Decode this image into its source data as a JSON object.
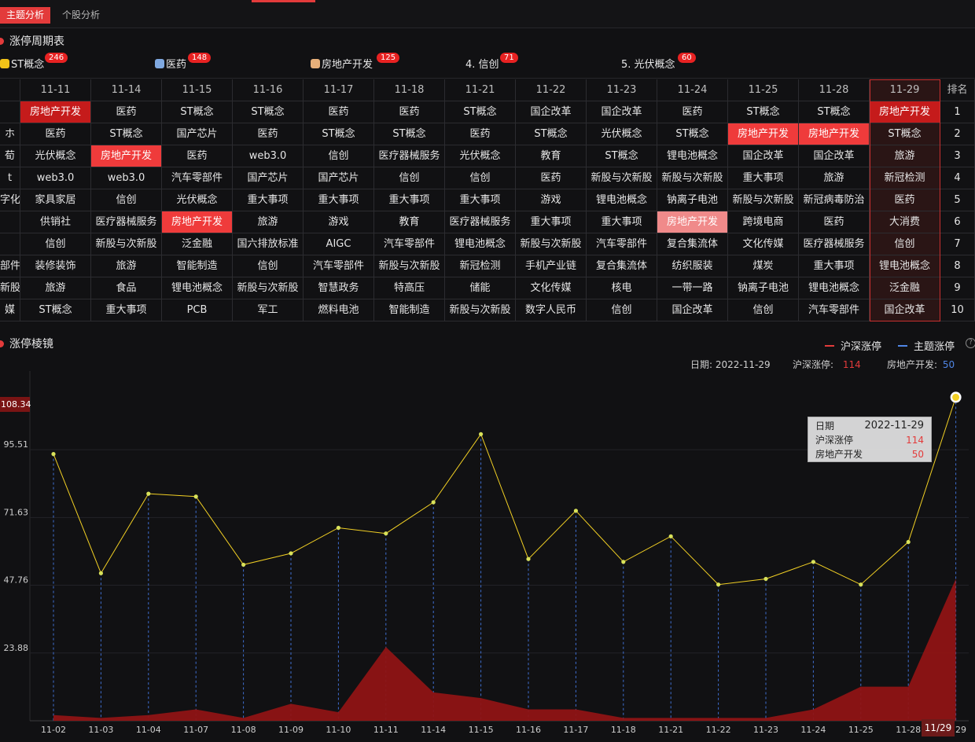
{
  "tabs": {
    "active": "主题分析",
    "other": "个股分析"
  },
  "limit_table": {
    "title": "涨停周期表",
    "themes": [
      {
        "rank_label": "",
        "name": "ST概念",
        "count": "246",
        "icon_color": "#f2c318",
        "icon": "hexagon-icon"
      },
      {
        "rank_label": "",
        "name": "医药",
        "count": "148",
        "icon_color": "#7fa8e0",
        "icon": "hexagon-icon"
      },
      {
        "rank_label": "",
        "name": "房地产开发",
        "count": "125",
        "icon_color": "#e8b07a",
        "icon": "hexagon-icon"
      },
      {
        "rank_label": "4.",
        "name": "信创",
        "count": "71",
        "icon_color": "",
        "icon": ""
      },
      {
        "rank_label": "5.",
        "name": "光伏概念",
        "count": "60",
        "icon_color": "",
        "icon": ""
      }
    ],
    "partial_col_header": "",
    "dates": [
      "11-11",
      "11-14",
      "11-15",
      "11-16",
      "11-17",
      "11-18",
      "11-21",
      "11-22",
      "11-23",
      "11-24",
      "11-25",
      "11-28",
      "11-29"
    ],
    "rank_header": "排名",
    "partial_col": [
      "",
      "ホ",
      "荀",
      "t",
      "字化",
      "",
      "",
      "部件",
      "新股",
      "媒"
    ],
    "rows": [
      [
        "房地产开发",
        "医药",
        "ST概念",
        "ST概念",
        "医药",
        "医药",
        "ST概念",
        "国企改革",
        "国企改革",
        "医药",
        "ST概念",
        "ST概念",
        "房地产开发"
      ],
      [
        "医药",
        "ST概念",
        "国产芯片",
        "医药",
        "ST概念",
        "ST概念",
        "医药",
        "ST概念",
        "光伏概念",
        "ST概念",
        "房地产开发",
        "房地产开发",
        "ST概念"
      ],
      [
        "光伏概念",
        "房地产开发",
        "医药",
        "web3.0",
        "信创",
        "医疗器械服务",
        "光伏概念",
        "教育",
        "ST概念",
        "锂电池概念",
        "国企改革",
        "国企改革",
        "旅游"
      ],
      [
        "web3.0",
        "web3.0",
        "汽车零部件",
        "国产芯片",
        "国产芯片",
        "信创",
        "信创",
        "医药",
        "新股与次新股",
        "新股与次新股",
        "重大事项",
        "旅游",
        "新冠检测"
      ],
      [
        "家具家居",
        "信创",
        "光伏概念",
        "重大事项",
        "重大事项",
        "重大事项",
        "重大事项",
        "游戏",
        "锂电池概念",
        "钠离子电池",
        "新股与次新股",
        "新冠病毒防治",
        "医药"
      ],
      [
        "供销社",
        "医疗器械服务",
        "房地产开发",
        "旅游",
        "游戏",
        "教育",
        "医疗器械服务",
        "重大事项",
        "重大事项",
        "房地产开发",
        "跨境电商",
        "医药",
        "大消费"
      ],
      [
        "信创",
        "新股与次新股",
        "泛金融",
        "国六排放标准",
        "AIGC",
        "汽车零部件",
        "锂电池概念",
        "新股与次新股",
        "汽车零部件",
        "复合集流体",
        "文化传媒",
        "医疗器械服务",
        "信创"
      ],
      [
        "装修装饰",
        "旅游",
        "智能制造",
        "信创",
        "汽车零部件",
        "新股与次新股",
        "新冠检测",
        "手机产业链",
        "复合集流体",
        "纺织服装",
        "煤炭",
        "重大事项",
        "锂电池概念"
      ],
      [
        "旅游",
        "食品",
        "锂电池概念",
        "新股与次新股",
        "智慧政务",
        "特高压",
        "储能",
        "文化传媒",
        "核电",
        "一带一路",
        "钠离子电池",
        "锂电池概念",
        "泛金融"
      ],
      [
        "ST概念",
        "重大事项",
        "PCB",
        "军工",
        "燃料电池",
        "智能制造",
        "新股与次新股",
        "数字人民币",
        "信创",
        "国企改革",
        "信创",
        "汽车零部件",
        "国企改革"
      ]
    ],
    "ranks": [
      "1",
      "2",
      "3",
      "4",
      "5",
      "6",
      "7",
      "8",
      "9",
      "10"
    ],
    "highlights": [
      {
        "row": 0,
        "col": 0,
        "style": "dark"
      },
      {
        "row": 0,
        "col": 12,
        "style": "dark"
      },
      {
        "row": 1,
        "col": 10,
        "style": "mid"
      },
      {
        "row": 1,
        "col": 11,
        "style": "mid"
      },
      {
        "row": 2,
        "col": 1,
        "style": "mid"
      },
      {
        "row": 5,
        "col": 2,
        "style": "mid"
      },
      {
        "row": 5,
        "col": 9,
        "style": "light"
      }
    ],
    "colors": {
      "dark": "#c51b1b",
      "mid": "#ef3b3b",
      "light": "#f08a8a",
      "selected_column": "#2a1515"
    }
  },
  "mirror": {
    "title": "涨停棱镜",
    "legend": [
      {
        "label": "沪深涨停",
        "color": "#e33b3b"
      },
      {
        "label": "主题涨停",
        "color": "#4f86e6"
      }
    ],
    "help_glyph": "?",
    "info": {
      "date_label": "日期:",
      "date": "2022-11-29",
      "total_label": "沪深涨停:",
      "total": "114",
      "theme_label": "房地产开发:",
      "theme": "50"
    },
    "tooltip": {
      "date_label": "日期",
      "date": "2022-11-29",
      "total_label": "沪深涨停",
      "total": "114",
      "theme_label": "房地产开发",
      "theme": "50"
    },
    "y_highlight": "108.34",
    "x_highlight": "11/29",
    "trailing_x_label": "29"
  },
  "chart_data": {
    "type": "line",
    "categories": [
      "11-02",
      "11-03",
      "11-04",
      "11-07",
      "11-08",
      "11-09",
      "11-10",
      "11-11",
      "11-14",
      "11-15",
      "11-16",
      "11-17",
      "11-18",
      "11-21",
      "11-22",
      "11-23",
      "11-24",
      "11-25",
      "11-28",
      "11-29"
    ],
    "y_ticks": [
      "95.51",
      "71.63",
      "47.76",
      "23.88"
    ],
    "ylim": [
      0,
      120
    ],
    "grid": true,
    "series": [
      {
        "name": "沪深涨停",
        "kind": "line",
        "color": "#f2d024",
        "values": [
          94,
          52,
          80,
          79,
          55,
          59,
          68,
          66,
          77,
          101,
          57,
          74,
          56,
          65,
          48,
          50,
          56,
          48,
          63,
          114
        ]
      },
      {
        "name": "主题涨停",
        "kind": "area",
        "color": "#8f1414",
        "values": [
          2,
          1,
          2,
          4,
          1,
          6,
          3,
          26,
          10,
          8,
          4,
          4,
          1,
          1,
          1,
          1,
          4,
          12,
          12,
          50
        ]
      }
    ]
  }
}
